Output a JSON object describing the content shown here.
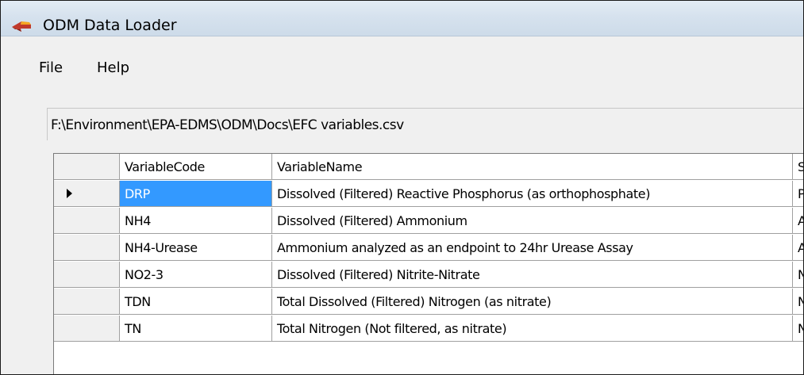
{
  "window": {
    "title": "ODM Data Loader",
    "icon": "app-arrow-icon"
  },
  "menu": {
    "items": [
      {
        "label": "File"
      },
      {
        "label": "Help"
      }
    ]
  },
  "file_path": "F:\\Environment\\EPA-EDMS\\ODM\\Docs\\EFC variables.csv",
  "grid": {
    "columns": [
      "VariableCode",
      "VariableName",
      "Specia"
    ],
    "selected_row": 0,
    "rows": [
      {
        "code": "DRP",
        "name": "Dissolved (Filtered) Reactive Phosphorus (as orthophosphate)",
        "spec": "P"
      },
      {
        "code": "NH4",
        "name": "Dissolved (Filtered) Ammonium",
        "spec": "A"
      },
      {
        "code": "NH4-Urease",
        "name": "Ammonium analyzed as an endpoint to 24hr Urease Assay",
        "spec": "A"
      },
      {
        "code": "NO2-3",
        "name": "Dissolved (Filtered) Nitrite-Nitrate",
        "spec": "N"
      },
      {
        "code": "TDN",
        "name": "Total Dissolved (Filtered) Nitrogen (as nitrate)",
        "spec": "N"
      },
      {
        "code": "TN",
        "name": "Total Nitrogen (Not filtered, as nitrate)",
        "spec": "N"
      }
    ]
  },
  "colors": {
    "selection": "#3399ff",
    "titlebar": "#d6e2ee"
  }
}
